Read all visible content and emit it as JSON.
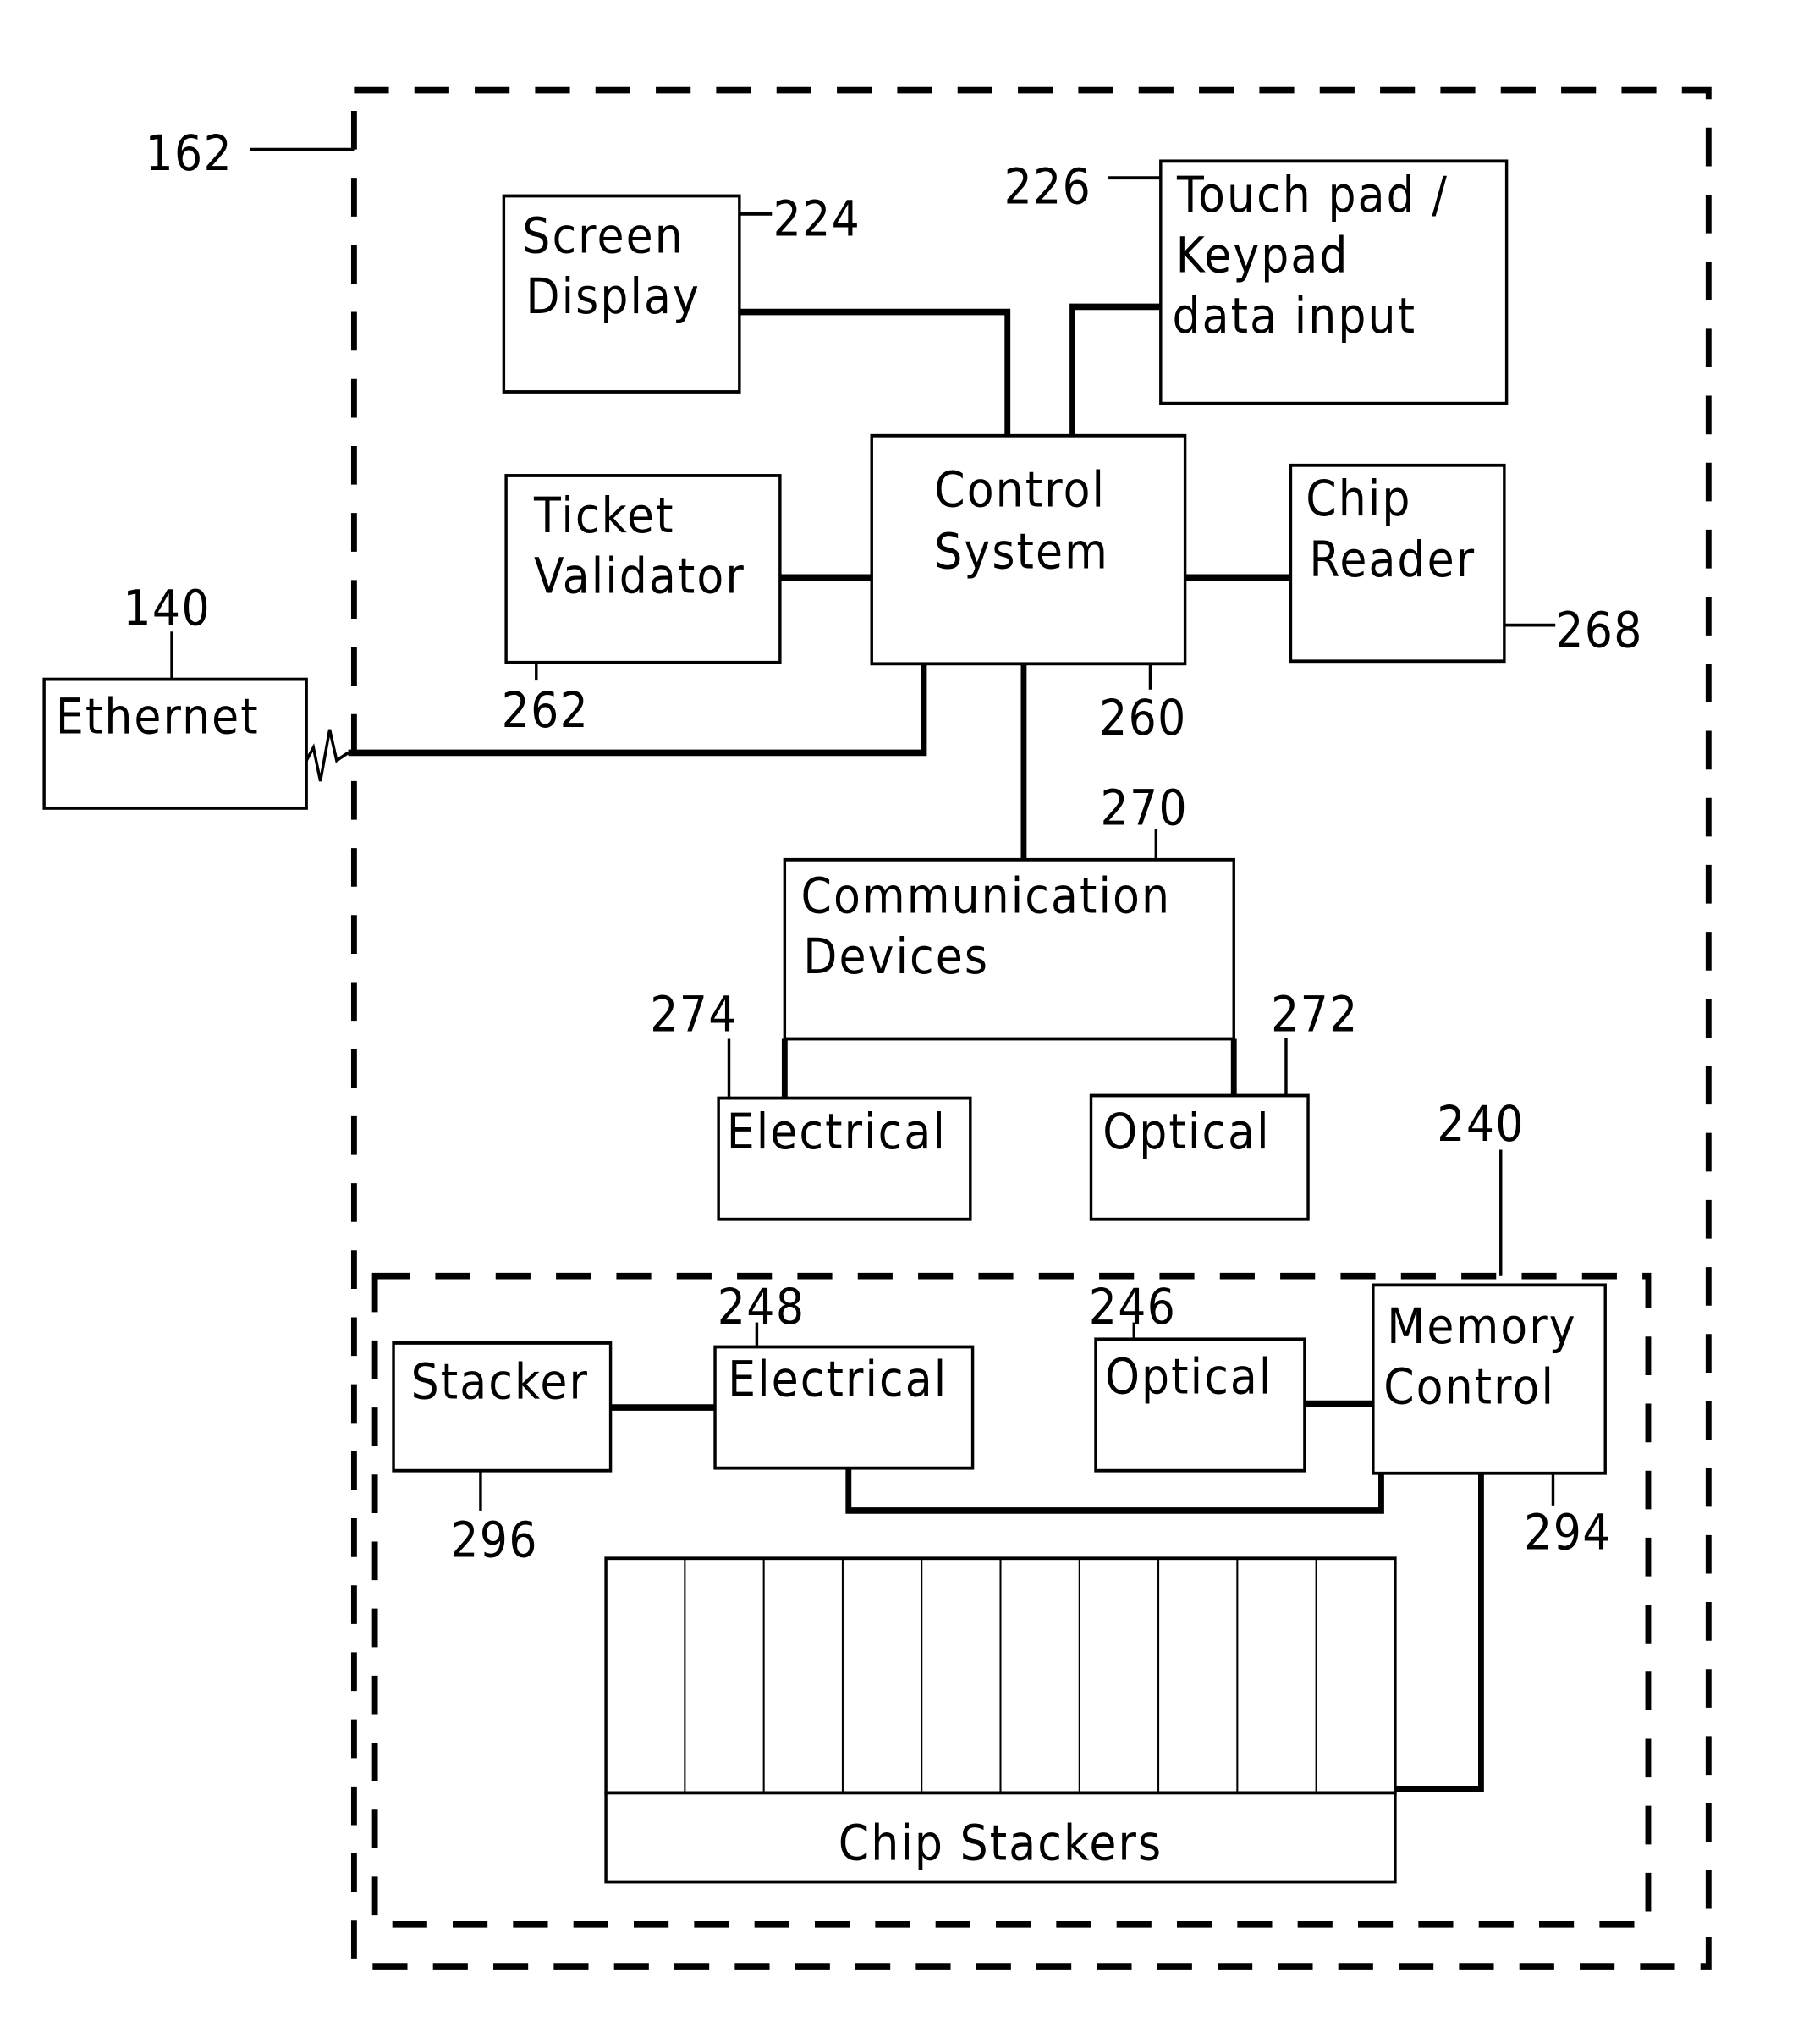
{
  "diagram": {
    "type": "block-diagram",
    "outer_ref": "162",
    "inner_ref": "240",
    "blocks": {
      "screen_display": {
        "lines": [
          "Screen",
          "Display"
        ],
        "ref": "224"
      },
      "touch_pad": {
        "lines": [
          "Touch pad /",
          "Keypad",
          "data input"
        ],
        "ref": "226"
      },
      "ticket_validator": {
        "lines": [
          "Ticket",
          "Validator"
        ],
        "ref": "262"
      },
      "control_system": {
        "lines": [
          "Control",
          "System"
        ],
        "ref": "260"
      },
      "chip_reader": {
        "lines": [
          "Chip",
          "Reader"
        ],
        "ref": "268"
      },
      "ethernet": {
        "lines": [
          "Ethernet"
        ],
        "ref": "140"
      },
      "communication_devices": {
        "lines": [
          "Communication",
          "Devices"
        ],
        "ref": "270"
      },
      "comm_electrical": {
        "lines": [
          "Electrical"
        ],
        "ref": "274"
      },
      "comm_optical": {
        "lines": [
          "Optical"
        ],
        "ref": "272"
      },
      "stacker": {
        "lines": [
          "Stacker"
        ],
        "ref": "296"
      },
      "inner_electrical": {
        "lines": [
          "Electrical"
        ],
        "ref": "248"
      },
      "inner_optical": {
        "lines": [
          "Optical"
        ],
        "ref": "246"
      },
      "memory_control": {
        "lines": [
          "Memory",
          "Control"
        ],
        "ref": "294"
      },
      "chip_stackers": {
        "lines": [
          "Chip Stackers"
        ],
        "columns": 10
      }
    }
  }
}
